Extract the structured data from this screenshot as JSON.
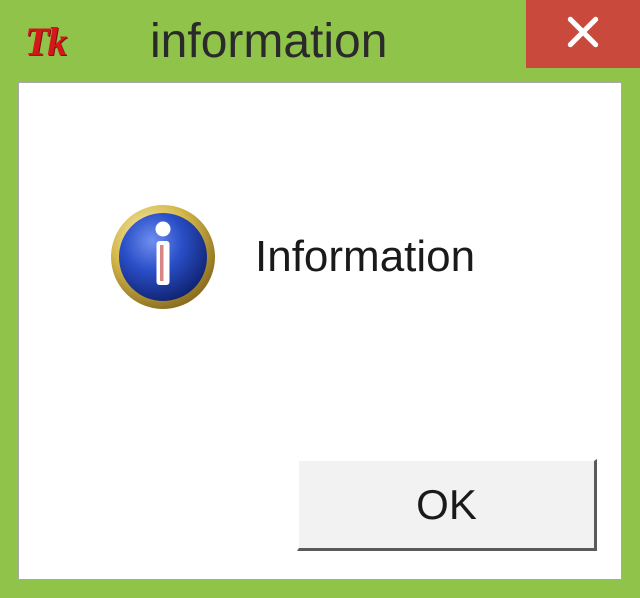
{
  "titlebar": {
    "app_icon_text": "Tk",
    "title": "information"
  },
  "dialog": {
    "message": "Information",
    "ok_label": "OK"
  },
  "icons": {
    "close": "close-icon",
    "info": "info-icon"
  },
  "colors": {
    "chrome": "#8fc34a",
    "close_bg": "#c94a3c",
    "info_circle": "#2a4fc7"
  }
}
